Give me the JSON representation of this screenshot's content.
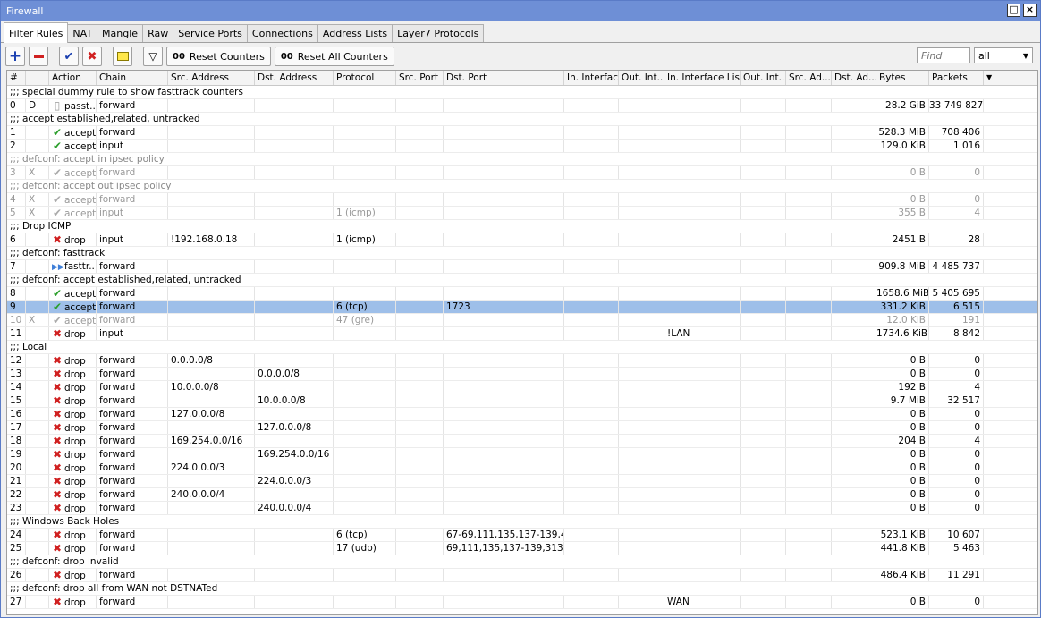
{
  "window": {
    "title": "Firewall"
  },
  "tabs": [
    "Filter Rules",
    "NAT",
    "Mangle",
    "Raw",
    "Service Ports",
    "Connections",
    "Address Lists",
    "Layer7 Protocols"
  ],
  "toolbar": {
    "reset_counters": "Reset Counters",
    "reset_all": "Reset All Counters",
    "counter_glyph": "00",
    "find_placeholder": "Find",
    "filter_value": "all"
  },
  "columns": [
    "#",
    "Action",
    "Chain",
    "Src. Address",
    "Dst. Address",
    "Protocol",
    "Src. Port",
    "Dst. Port",
    "In. Interface",
    "Out. Int...",
    "In. Interface List",
    "Out. Int...",
    "Src. Ad...",
    "Dst. Ad...",
    "Bytes",
    "Packets"
  ],
  "rows": [
    {
      "type": "comment",
      "text": ";;; special dummy rule to show fasttrack counters"
    },
    {
      "n": "0",
      "flag": "D",
      "icon": "doc",
      "action": "passt...",
      "chain": "forward",
      "bytes": "28.2 GiB",
      "packets": "33 749 827"
    },
    {
      "type": "comment",
      "text": ";;; accept established,related, untracked"
    },
    {
      "n": "1",
      "icon": "ok",
      "action": "accept",
      "chain": "forward",
      "bytes": "528.3 MiB",
      "packets": "708 406"
    },
    {
      "n": "2",
      "icon": "ok",
      "action": "accept",
      "chain": "input",
      "bytes": "129.0 KiB",
      "packets": "1 016"
    },
    {
      "type": "comment",
      "dis": true,
      "text": ";;; defconf: accept in ipsec policy"
    },
    {
      "n": "3",
      "flag": "X",
      "dis": true,
      "icon": "ok",
      "action": "accept",
      "chain": "forward",
      "bytes": "0 B",
      "packets": "0"
    },
    {
      "type": "comment",
      "dis": true,
      "text": ";;; defconf: accept out ipsec policy"
    },
    {
      "n": "4",
      "flag": "X",
      "dis": true,
      "icon": "ok",
      "action": "accept",
      "chain": "forward",
      "bytes": "0 B",
      "packets": "0"
    },
    {
      "n": "5",
      "flag": "X",
      "dis": true,
      "icon": "ok",
      "action": "accept",
      "chain": "input",
      "proto": "1 (icmp)",
      "bytes": "355 B",
      "packets": "4"
    },
    {
      "type": "comment",
      "text": ";;; Drop ICMP"
    },
    {
      "n": "6",
      "icon": "x",
      "action": "drop",
      "chain": "input",
      "src": "!192.168.0.18",
      "proto": "1 (icmp)",
      "bytes": "2451 B",
      "packets": "28"
    },
    {
      "type": "comment",
      "text": ";;; defconf: fasttrack"
    },
    {
      "n": "7",
      "icon": "ff",
      "action": "fasttr...",
      "chain": "forward",
      "bytes": "909.8 MiB",
      "packets": "4 485 737"
    },
    {
      "type": "comment",
      "text": ";;; defconf: accept established,related, untracked"
    },
    {
      "n": "8",
      "icon": "ok",
      "action": "accept",
      "chain": "forward",
      "bytes": "1658.6 MiB",
      "packets": "5 405 695"
    },
    {
      "n": "9",
      "sel": true,
      "icon": "ok",
      "action": "accept",
      "chain": "forward",
      "proto": "6 (tcp)",
      "dport": "1723",
      "bytes": "331.2 KiB",
      "packets": "6 515"
    },
    {
      "n": "10",
      "flag": "X",
      "dis": true,
      "icon": "ok",
      "action": "accept",
      "chain": "forward",
      "proto": "47 (gre)",
      "bytes": "12.0 KiB",
      "packets": "191"
    },
    {
      "n": "11",
      "icon": "x",
      "action": "drop",
      "chain": "input",
      "inlist": "!LAN",
      "bytes": "1734.6 KiB",
      "packets": "8 842"
    },
    {
      "type": "comment",
      "text": ";;; Local"
    },
    {
      "n": "12",
      "icon": "x",
      "action": "drop",
      "chain": "forward",
      "src": "0.0.0.0/8",
      "bytes": "0 B",
      "packets": "0"
    },
    {
      "n": "13",
      "icon": "x",
      "action": "drop",
      "chain": "forward",
      "dst": "0.0.0.0/8",
      "bytes": "0 B",
      "packets": "0"
    },
    {
      "n": "14",
      "icon": "x",
      "action": "drop",
      "chain": "forward",
      "src": "10.0.0.0/8",
      "bytes": "192 B",
      "packets": "4"
    },
    {
      "n": "15",
      "icon": "x",
      "action": "drop",
      "chain": "forward",
      "dst": "10.0.0.0/8",
      "bytes": "9.7 MiB",
      "packets": "32 517"
    },
    {
      "n": "16",
      "icon": "x",
      "action": "drop",
      "chain": "forward",
      "src": "127.0.0.0/8",
      "bytes": "0 B",
      "packets": "0"
    },
    {
      "n": "17",
      "icon": "x",
      "action": "drop",
      "chain": "forward",
      "dst": "127.0.0.0/8",
      "bytes": "0 B",
      "packets": "0"
    },
    {
      "n": "18",
      "icon": "x",
      "action": "drop",
      "chain": "forward",
      "src": "169.254.0.0/16",
      "bytes": "204 B",
      "packets": "4"
    },
    {
      "n": "19",
      "icon": "x",
      "action": "drop",
      "chain": "forward",
      "dst": "169.254.0.0/16",
      "bytes": "0 B",
      "packets": "0"
    },
    {
      "n": "20",
      "icon": "x",
      "action": "drop",
      "chain": "forward",
      "src": "224.0.0.0/3",
      "bytes": "0 B",
      "packets": "0"
    },
    {
      "n": "21",
      "icon": "x",
      "action": "drop",
      "chain": "forward",
      "dst": "224.0.0.0/3",
      "bytes": "0 B",
      "packets": "0"
    },
    {
      "n": "22",
      "icon": "x",
      "action": "drop",
      "chain": "forward",
      "src": "240.0.0.0/4",
      "bytes": "0 B",
      "packets": "0"
    },
    {
      "n": "23",
      "icon": "x",
      "action": "drop",
      "chain": "forward",
      "dst": "240.0.0.0/4",
      "bytes": "0 B",
      "packets": "0"
    },
    {
      "type": "comment",
      "text": ";;; Windows Back Holes"
    },
    {
      "n": "24",
      "icon": "x",
      "action": "drop",
      "chain": "forward",
      "proto": "6 (tcp)",
      "dport": "67-69,111,135,137-139,4...",
      "bytes": "523.1 KiB",
      "packets": "10 607"
    },
    {
      "n": "25",
      "icon": "x",
      "action": "drop",
      "chain": "forward",
      "proto": "17 (udp)",
      "dport": "69,111,135,137-139,313...",
      "bytes": "441.8 KiB",
      "packets": "5 463"
    },
    {
      "type": "comment",
      "text": ";;; defconf: drop invalid"
    },
    {
      "n": "26",
      "icon": "x",
      "action": "drop",
      "chain": "forward",
      "bytes": "486.4 KiB",
      "packets": "11 291"
    },
    {
      "type": "comment",
      "text": ";;; defconf:  drop all from WAN not DSTNATed"
    },
    {
      "n": "27",
      "icon": "x",
      "action": "drop",
      "chain": "forward",
      "inlist": "WAN",
      "bytes": "0 B",
      "packets": "0"
    }
  ]
}
